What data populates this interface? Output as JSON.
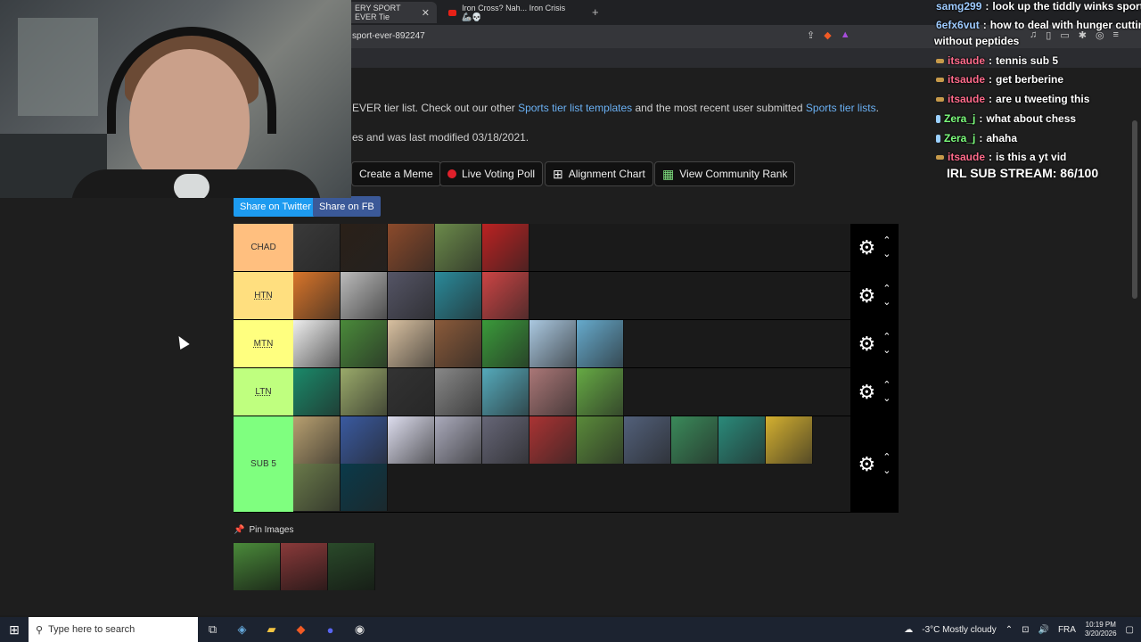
{
  "browser": {
    "tab1_title": "ERY SPORT EVER Tie",
    "tab2_title": "Iron Cross? Nah... Iron Crisis 🦾💀",
    "url": "sport-ever-892247"
  },
  "page": {
    "desc1_pre": "EVER tier list. Check out our other ",
    "desc1_link1": "Sports tier list templates",
    "desc1_mid": " and the most recent user submitted ",
    "desc1_link2": "Sports tier lists",
    "desc1_post": ".",
    "desc2": "es and was last modified 03/18/2021.",
    "buttons": {
      "meme": "Create a Meme",
      "poll": "Live Voting Poll",
      "alignment": "Alignment Chart",
      "community": "View Community Rank"
    },
    "share_twitter": "Share on Twitter",
    "share_fb": "Share on FB",
    "pin_label": "Pin Images"
  },
  "tiers": [
    {
      "label": "CHAD",
      "color": "#ffbf7f",
      "images": [
        "f1-racing",
        "mma-fighter",
        "american-football",
        "rugby-ball",
        "boxing-glove"
      ]
    },
    {
      "label": "HTN",
      "color": "#ffdf7f",
      "images": [
        "basketball",
        "hockey-puck",
        "motor-racing",
        "surfing",
        "track-running"
      ]
    },
    {
      "label": "MTN",
      "color": "#ffff7f",
      "images": [
        "baseball",
        "golf",
        "table-tennis",
        "skateboarding",
        "soccer",
        "skiing",
        "water-polo"
      ]
    },
    {
      "label": "LTN",
      "color": "#bfff7f",
      "images": [
        "billiards",
        "croquet",
        "fencing",
        "lacrosse",
        "swimming",
        "volleyball",
        "tennis"
      ]
    },
    {
      "label": "SUB 5",
      "color": "#7fff7f",
      "images": [
        "fingerboard",
        "bowling",
        "cricket",
        "curling",
        "cycling",
        "darts",
        "disc-golf",
        "esports",
        "field-hockey",
        "ping-pong",
        "badminton",
        "frisbee",
        "diving"
      ]
    }
  ],
  "pin_images": [
    "stadium-soccer",
    "stadium-crowd",
    "stadium-night"
  ],
  "chat": [
    {
      "user": "samg299",
      "color": "#9ecbff",
      "text": "look up the tiddly winks sport"
    },
    {
      "user": "6efx6vut",
      "color": "#9ecbff",
      "text": "how to deal with hunger cutting"
    },
    {
      "user": "",
      "color": "#ffffff",
      "text": "without peptides"
    },
    {
      "user": "itsaude",
      "color": "#ff6b8b",
      "text": "tennis sub 5"
    },
    {
      "user": "itsaude",
      "color": "#ff6b8b",
      "text": "get berberine"
    },
    {
      "user": "itsaude",
      "color": "#ff6b8b",
      "text": "are u tweeting this"
    },
    {
      "user": "Zera_j",
      "color": "#7dff7d",
      "text": "what about chess"
    },
    {
      "user": "Zera_j",
      "color": "#7dff7d",
      "text": "ahaha"
    },
    {
      "user": "itsaude",
      "color": "#ff6b8b",
      "text": "is this a yt vid"
    }
  ],
  "sub_stream": "IRL SUB STREAM: 86/100",
  "taskbar": {
    "search_placeholder": "Type here to search",
    "weather": "-3°C  Mostly cloudy",
    "lang": "FRA",
    "time": "10:19 PM",
    "date": "3/20/2026"
  }
}
